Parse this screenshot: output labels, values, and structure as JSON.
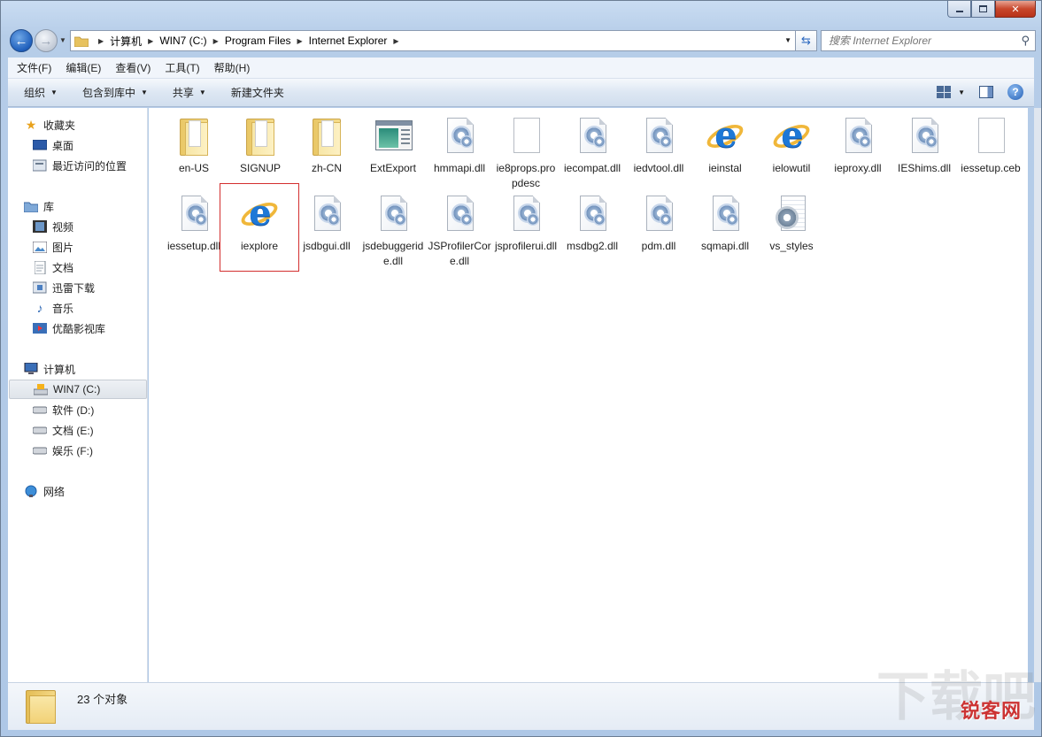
{
  "window": {
    "caption_buttons": {
      "minimize": "minimize-icon",
      "maximize": "maximize-icon",
      "close": "✕"
    }
  },
  "address": {
    "crumbs": [
      "计算机",
      "WIN7 (C:)",
      "Program Files",
      "Internet Explorer"
    ],
    "search_placeholder": "搜索 Internet Explorer"
  },
  "menu": [
    "文件(F)",
    "编辑(E)",
    "查看(V)",
    "工具(T)",
    "帮助(H)"
  ],
  "toolbar": {
    "organize": "组织",
    "include_library": "包含到库中",
    "share": "共享",
    "new_folder": "新建文件夹"
  },
  "navpane": {
    "favorites": "收藏夹",
    "desktop": "桌面",
    "recent": "最近访问的位置",
    "libraries": "库",
    "videos": "视频",
    "pictures": "图片",
    "documents": "文档",
    "xunlei": "迅雷下载",
    "music": "音乐",
    "youku": "优酷影视库",
    "computer": "计算机",
    "drive_c": "WIN7 (C:)",
    "drive_d": "软件 (D:)",
    "drive_e": "文档 (E:)",
    "drive_f": "娱乐 (F:)",
    "network": "网络"
  },
  "files": [
    {
      "name": "en-US",
      "type": "folder"
    },
    {
      "name": "SIGNUP",
      "type": "folder"
    },
    {
      "name": "zh-CN",
      "type": "folder"
    },
    {
      "name": "ExtExport",
      "type": "exe"
    },
    {
      "name": "hmmapi.dll",
      "type": "dll"
    },
    {
      "name": "ie8props.propdesc",
      "type": "blank"
    },
    {
      "name": "iecompat.dll",
      "type": "dll"
    },
    {
      "name": "iedvtool.dll",
      "type": "dll"
    },
    {
      "name": "ieinstal",
      "type": "ie"
    },
    {
      "name": "ielowutil",
      "type": "ie"
    },
    {
      "name": "ieproxy.dll",
      "type": "dll"
    },
    {
      "name": "IEShims.dll",
      "type": "dll"
    },
    {
      "name": "iessetup.ceb",
      "type": "blank"
    },
    {
      "name": "iessetup.dll",
      "type": "dll"
    },
    {
      "name": "iexplore",
      "type": "ie",
      "highlight": true
    },
    {
      "name": "jsdbgui.dll",
      "type": "dll"
    },
    {
      "name": "jsdebuggeride.dll",
      "type": "dll"
    },
    {
      "name": "JSProfilerCore.dll",
      "type": "dll"
    },
    {
      "name": "jsprofilerui.dll",
      "type": "dll"
    },
    {
      "name": "msdbg2.dll",
      "type": "dll"
    },
    {
      "name": "pdm.dll",
      "type": "dll"
    },
    {
      "name": "sqmapi.dll",
      "type": "dll"
    },
    {
      "name": "vs_styles",
      "type": "settings"
    }
  ],
  "status": {
    "count_text": "23 个对象"
  },
  "watermark": "锐客网"
}
